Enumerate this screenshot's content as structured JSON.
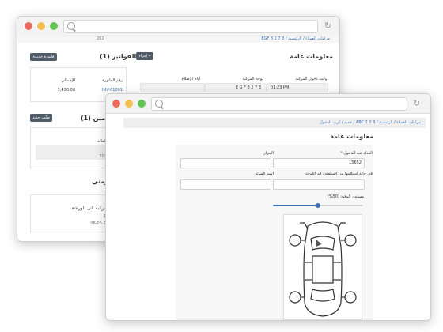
{
  "back_window": {
    "breadcrumb": "EGF 8 2 7 3  /  مركبات العملاء  /  الرئيسية",
    "page_date": "202",
    "general_info": {
      "title": "معلومات عامة",
      "actions_label": "إجراء ▾",
      "col_entry_time": "وقت دخول المركبة",
      "col_plate": "لوحة المركبة",
      "col_repair_days": "أيام الإصلاح",
      "entry_time": "01:23 PM",
      "plate": "E G F 8 2 7 3"
    },
    "invoices": {
      "title": "الفواتير (1)",
      "new_button": "فاتورة جديدة",
      "col_number": "رقم الفاتورة",
      "col_total": "الإجمالي",
      "number": "INV-01001",
      "total": "1,430.08"
    },
    "insurance": {
      "title": "تأمين (1)",
      "new_button": "طلب جديد",
      "col_status": "الحالة",
      "date": "202"
    },
    "timeline": {
      "title": "زمني",
      "entry_text": "لمركبة الى الورشة",
      "num": "13",
      "date": "08-05-20"
    }
  },
  "front_window": {
    "breadcrumb": "جديد  /  كرت الدخول  /  ABC 1 2 3  /  مركبات العملاء  /  الرئيسية",
    "form": {
      "title": "معلومات عامة",
      "odometer_label": "العداد عند الدخول",
      "required_mark": "*",
      "odometer_value": "15652",
      "parts_label": "الجزاز",
      "plate_received_label": "في حالة استلامها من السلطة رقم اللوحة",
      "driver_label": "اسم السائق",
      "fuel_label": "مستوى الوقود (50%)",
      "fuel_level": 0.5
    }
  },
  "colors": {
    "close": "#ec6a5e",
    "minimize": "#f4bf4f",
    "zoom": "#61c554",
    "accent": "#3a6fb4",
    "dark_button": "#4f5b66"
  },
  "icons": [
    "search-icon",
    "reload-icon",
    "car-diagram-icon",
    "cursor-icon"
  ]
}
